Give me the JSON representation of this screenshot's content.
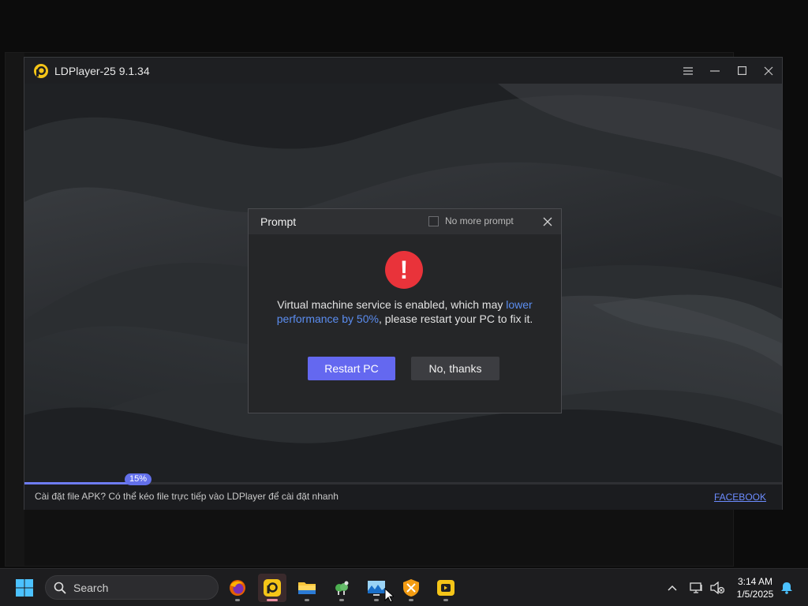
{
  "window": {
    "title": "LDPlayer-25 9.1.34",
    "controls": [
      "menu-icon",
      "minimize-icon",
      "maximize-icon",
      "close-icon"
    ]
  },
  "dialog": {
    "title": "Prompt",
    "no_more_prompt_label": "No more prompt",
    "no_more_prompt_checked": false,
    "message_part1": "Virtual machine service is enabled, which may ",
    "message_highlight": "lower performance by 50%",
    "message_part2": ", please restart your PC to fix it.",
    "restart_button": "Restart PC",
    "no_thanks_button": "No, thanks",
    "alert_glyph": "!"
  },
  "progress": {
    "percent": 15,
    "label": "15%"
  },
  "bottom_bar": {
    "hint": "Cài đặt file APK? Có thể kéo file trực tiếp vào LDPlayer để cài đặt nhanh",
    "link": "FACEBOOK"
  },
  "taskbar": {
    "search_placeholder": "Search",
    "apps": [
      "firefox-icon",
      "ldplayer-icon",
      "file-explorer-icon",
      "sheep-app-icon",
      "monitor-app-icon",
      "tools-app-icon",
      "media-app-icon"
    ],
    "time": "3:14 AM",
    "date": "1/5/2025"
  },
  "colors": {
    "accent": "#6468f0",
    "alert_red": "#e9333a",
    "link_blue": "#6c8cff",
    "highlight_blue": "#5b8df0"
  }
}
